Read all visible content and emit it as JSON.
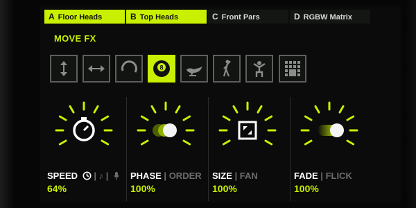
{
  "tabs": [
    {
      "letter": "A",
      "label": "Floor Heads",
      "active": true
    },
    {
      "letter": "B",
      "label": "Top Heads",
      "active": true
    },
    {
      "letter": "C",
      "label": "Front Pars",
      "active": false
    },
    {
      "letter": "D",
      "label": "RGBW Matrix",
      "active": false
    }
  ],
  "section_title": "MOVE FX",
  "fx_buttons": [
    {
      "icon": "vertical-arrows-icon"
    },
    {
      "icon": "horizontal-arrows-icon"
    },
    {
      "icon": "circle-arc-icon"
    },
    {
      "icon": "eight-ball-icon",
      "label": "8",
      "selected": true
    },
    {
      "icon": "magic-lamp-icon"
    },
    {
      "icon": "dancer-icon"
    },
    {
      "icon": "performer-icon"
    },
    {
      "icon": "matrix-grid-icon"
    }
  ],
  "params": [
    {
      "main": "SPEED",
      "sep": "|",
      "alt_icons": [
        "clock-icon",
        "note-icon",
        "mic-icon"
      ],
      "value": "64%"
    },
    {
      "main": "PHASE",
      "sep": "|",
      "alt": "ORDER",
      "value": "100%"
    },
    {
      "main": "SIZE",
      "sep": "|",
      "alt": "FAN",
      "value": "100%"
    },
    {
      "main": "FADE",
      "sep": "|",
      "alt": "FLICK",
      "value": "100%"
    }
  ],
  "colors": {
    "accent": "#c8f000",
    "text": "#ffffff",
    "muted": "#6b6e6b"
  }
}
